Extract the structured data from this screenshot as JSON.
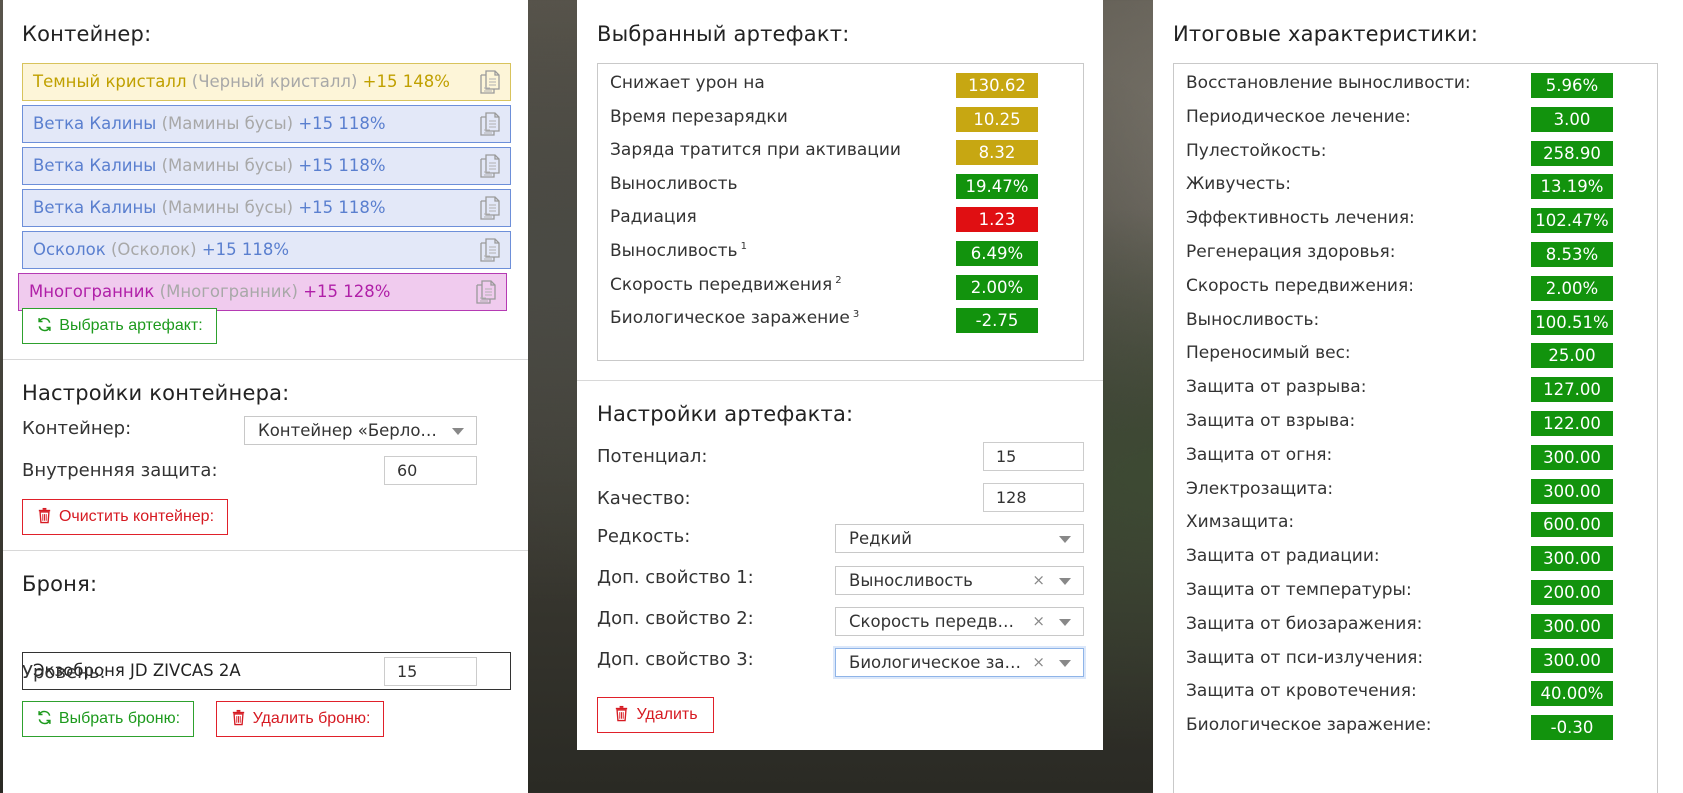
{
  "container_panel": {
    "heading": "Контейнер:",
    "items": [
      {
        "name": "Темный кристалл",
        "orig": "(Черный кристалл)",
        "stats": "+15 148%",
        "level": "yellow"
      },
      {
        "name": "Ветка Калины",
        "orig": "(Мамины бусы)",
        "stats": "+15 118%",
        "level": "blue"
      },
      {
        "name": "Ветка Калины",
        "orig": "(Мамины бусы)",
        "stats": "+15 118%",
        "level": "blue"
      },
      {
        "name": "Ветка Калины",
        "orig": "(Мамины бусы)",
        "stats": "+15 118%",
        "level": "blue"
      },
      {
        "name": "Осколок",
        "orig": "(Осколок)",
        "stats": "+15 118%",
        "level": "blue"
      },
      {
        "name": "Многогранник",
        "orig": "(Многогранник)",
        "stats": "+15 128%",
        "level": "violet"
      }
    ],
    "choose_artifact": "Выбрать артефакт:"
  },
  "container_settings": {
    "heading": "Настройки контейнера:",
    "container_label": "Контейнер:",
    "container_value": "Контейнер «Берлога…",
    "protection_label": "Внутренняя защита:",
    "protection_value": "60",
    "clear_button": "Очистить контейнер:"
  },
  "armor": {
    "heading": "Броня:",
    "name": "Экзоброня JD ZIVCAS 2A",
    "level_label": "Уровень:",
    "level_value": "15",
    "choose_button": "Выбрать броню:",
    "delete_button": "Удалить броню:"
  },
  "selected_artifact": {
    "heading": "Выбранный артефакт:",
    "stats": [
      {
        "name": "Снижает урон на",
        "sup": "",
        "value": "130.62",
        "color": "yellow"
      },
      {
        "name": "Время перезарядки",
        "sup": "",
        "value": "10.25",
        "color": "yellow"
      },
      {
        "name": "Заряда тратится при активации",
        "sup": "",
        "value": "8.32",
        "color": "yellow"
      },
      {
        "name": "Выносливость",
        "sup": "",
        "value": "19.47%",
        "color": "green"
      },
      {
        "name": "Радиация",
        "sup": "",
        "value": "1.23",
        "color": "red"
      },
      {
        "name": "Выносливость",
        "sup": "1",
        "value": "6.49%",
        "color": "green"
      },
      {
        "name": "Скорость передвижения",
        "sup": "2",
        "value": "2.00%",
        "color": "green"
      },
      {
        "name": "Биологическое заражение",
        "sup": "3",
        "value": "-2.75",
        "color": "green"
      }
    ]
  },
  "artifact_settings": {
    "heading": "Настройки артефакта:",
    "potential_label": "Потенциал:",
    "potential_value": "15",
    "quality_label": "Качество:",
    "quality_value": "128",
    "rarity_label": "Редкость:",
    "rarity_value": "Редкий",
    "prop1_label": "Доп. свойство 1:",
    "prop1_value": "Выносливость",
    "prop2_label": "Доп. свойство 2:",
    "prop2_value": "Скорость передви…",
    "prop3_label": "Доп. свойство 3:",
    "prop3_value": "Биологическое за…",
    "clear_glyph": "×",
    "delete_button": "Удалить"
  },
  "totals": {
    "heading": "Итоговые характеристики:",
    "stats": [
      {
        "name": "Восстановление выносливости:",
        "value": "5.96%"
      },
      {
        "name": "Периодическое лечение:",
        "value": "3.00"
      },
      {
        "name": "Пулестойкость:",
        "value": "258.90"
      },
      {
        "name": "Живучесть:",
        "value": "13.19%"
      },
      {
        "name": "Эффективность лечения:",
        "value": "102.47%"
      },
      {
        "name": "Регенерация здоровья:",
        "value": "8.53%"
      },
      {
        "name": "Скорость передвижения:",
        "value": "2.00%"
      },
      {
        "name": "Выносливость:",
        "value": "100.51%"
      },
      {
        "name": "Переносимый вес:",
        "value": "25.00"
      },
      {
        "name": "Защита от разрыва:",
        "value": "127.00"
      },
      {
        "name": "Защита от взрыва:",
        "value": "122.00"
      },
      {
        "name": "Защита от огня:",
        "value": "300.00"
      },
      {
        "name": "Электрозащита:",
        "value": "300.00"
      },
      {
        "name": "Химзащита:",
        "value": "600.00"
      },
      {
        "name": "Защита от радиации:",
        "value": "300.00"
      },
      {
        "name": "Защита от температуры:",
        "value": "200.00"
      },
      {
        "name": "Защита от биозаражения:",
        "value": "300.00"
      },
      {
        "name": "Защита от пси-излучения:",
        "value": "300.00"
      },
      {
        "name": "Защита от кровотечения:",
        "value": "40.00%"
      },
      {
        "name": "Биологическое заражение:",
        "value": "-0.30"
      }
    ]
  },
  "colors": {
    "green": "#12930d",
    "yellow": "#c7a712",
    "red": "#e00f12",
    "button_green": "#1d9a1d",
    "button_red": "#d61a22"
  },
  "icons": {
    "copy": "copy-icon",
    "refresh": "refresh-icon",
    "trash": "trash-icon",
    "caret": "chevron-down-icon"
  }
}
